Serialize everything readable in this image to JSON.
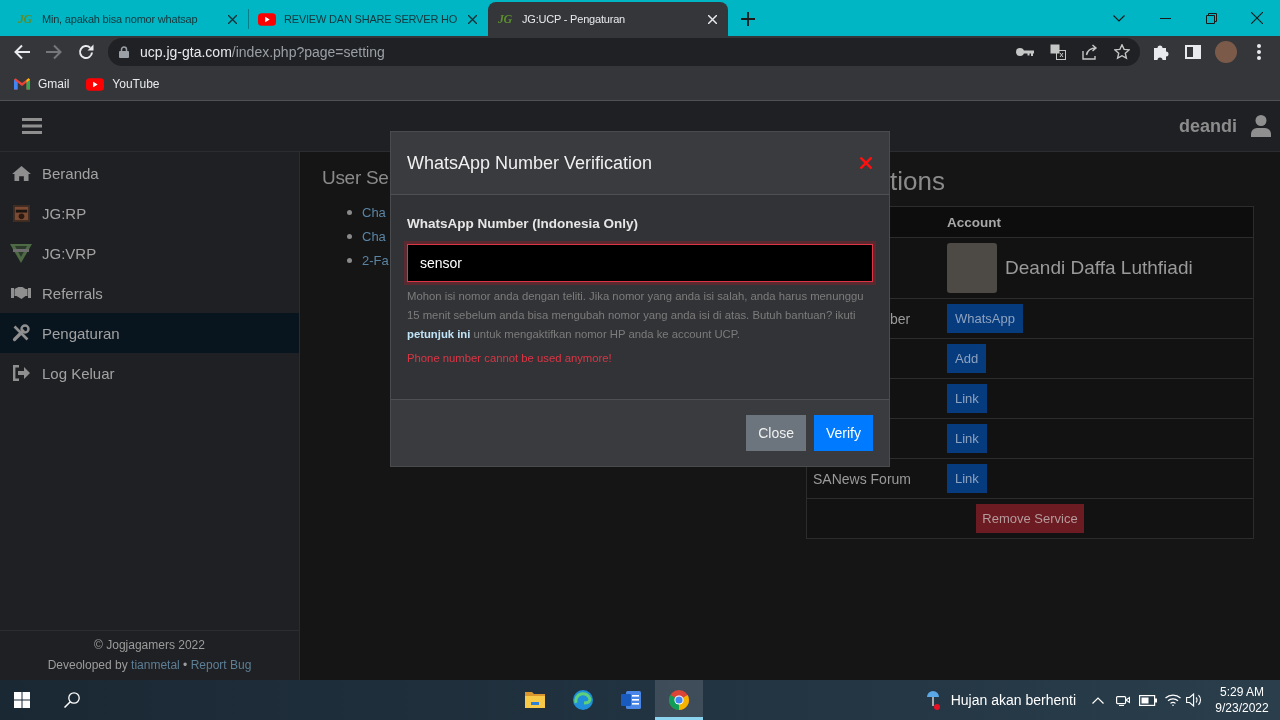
{
  "browser": {
    "tabs": [
      {
        "logo": "JG",
        "title": "Min, apakah bisa nomor whatsap",
        "selected": false
      },
      {
        "title": "REVIEW DAN SHARE SERVER HO",
        "selected": false
      },
      {
        "logo": "JG",
        "title": "JG:UCP - Pengaturan",
        "selected": true
      }
    ],
    "back_disabled": false,
    "forward_disabled": true,
    "address": {
      "host": "ucp.jg-gta.com",
      "path": "/index.php?page=setting"
    },
    "bookmarks": [
      {
        "label": "Gmail"
      },
      {
        "label": "YouTube"
      }
    ]
  },
  "navbar": {
    "username": "deandi"
  },
  "sidebar": {
    "items": [
      {
        "label": "Beranda",
        "selected": false
      },
      {
        "label": "JG:RP",
        "selected": false
      },
      {
        "label": "JG:VRP",
        "selected": false
      },
      {
        "label": "Referrals",
        "selected": false
      },
      {
        "label": "Pengaturan",
        "selected": true
      },
      {
        "label": "Log Keluar",
        "selected": false
      }
    ],
    "footer": {
      "copyright": "© Jogjagamers 2022",
      "credit": "Deveoloped by",
      "author": "tianmetal",
      "separator": "•",
      "report": "Report Bug"
    }
  },
  "user_settings": {
    "title": "User Se",
    "links": [
      "Cha",
      "Cha",
      "2-Fa"
    ]
  },
  "associations": {
    "title": "tions",
    "column_2": "Account",
    "rows": [
      {
        "kind": "profile",
        "name": "Deandi Daffa Luthfiadi"
      },
      {
        "kind": "service",
        "label": "ber",
        "partly_hidden": true,
        "button": "WhatsApp"
      },
      {
        "kind": "service",
        "button": "Add"
      },
      {
        "kind": "service",
        "button": "Link"
      },
      {
        "kind": "service",
        "button": "Link"
      },
      {
        "kind": "service",
        "label": "SANews Forum",
        "partly_hidden": false,
        "button": "Link"
      },
      {
        "kind": "remove",
        "button": "Remove Service"
      }
    ]
  },
  "dialog": {
    "title": "WhatsApp Number Verification",
    "field_label": "WhatsApp Number (Indonesia Only)",
    "value": "sensor",
    "invalid": true,
    "help": {
      "before": "Mohon isi nomor anda dengan teliti. Jika nomor yang anda isi salah, anda harus menunggu 15 menit sebelum anda bisa mengubah nomor yang anda isi di atas. Butuh bantuan? ikuti",
      "link": "petunjuk ini",
      "after": "untuk mengaktifkan nomor HP anda ke account UCP."
    },
    "error": "Phone number cannot be used anymore!",
    "buttons": [
      {
        "label": "Close",
        "kind": "secondary"
      },
      {
        "label": "Verify",
        "kind": "primary"
      }
    ]
  },
  "taskbar": {
    "apps": [
      {
        "selected": false
      },
      {
        "selected": false
      },
      {
        "selected": false
      },
      {
        "selected": true
      }
    ],
    "weather": "Hujan akan berhenti",
    "time": "5:29 AM",
    "date": "9/23/2022"
  }
}
